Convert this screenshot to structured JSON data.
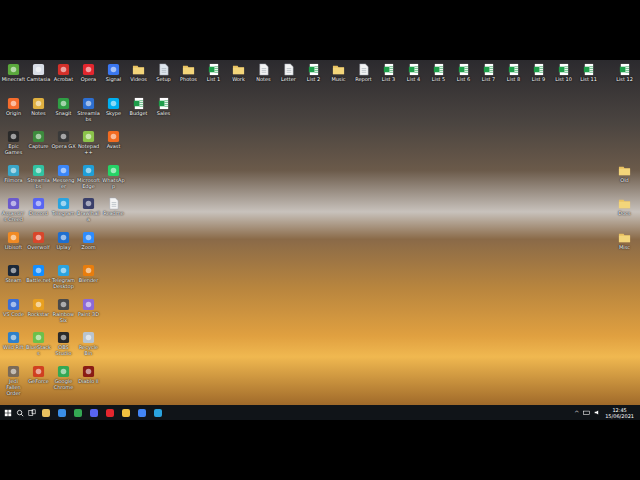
{
  "desktop": {
    "columns": [
      {
        "icons": [
          {
            "label": "Minecraft",
            "kind": "app",
            "color": "#5aa83c"
          },
          {
            "label": "Origin",
            "kind": "app",
            "color": "#f56c2d"
          },
          {
            "label": "Epic Games",
            "kind": "app",
            "color": "#2a2a2a"
          },
          {
            "label": "Filmora",
            "kind": "app",
            "color": "#3aa6c8"
          },
          {
            "label": "Assassin's Creed",
            "kind": "app",
            "color": "#6a5acd"
          },
          {
            "label": "Ubisoft",
            "kind": "app",
            "color": "#f08a24"
          },
          {
            "label": "Steam",
            "kind": "app",
            "color": "#1b2838"
          },
          {
            "label": "VS Code",
            "kind": "app",
            "color": "#3b6fd6"
          },
          {
            "label": "Wild Rift",
            "kind": "app",
            "color": "#2f80c9"
          },
          {
            "label": "Jedi Fallen Order",
            "kind": "app",
            "color": "#7a6a58"
          }
        ]
      },
      {
        "icons": [
          {
            "label": "Camtasia",
            "kind": "app",
            "color": "#d8dde6"
          },
          {
            "label": "Notes",
            "kind": "app",
            "color": "#e0b040"
          },
          {
            "label": "Capture",
            "kind": "app",
            "color": "#3d8b3d"
          },
          {
            "label": "Streamlabs",
            "kind": "app",
            "color": "#31c3a2"
          },
          {
            "label": "Discord",
            "kind": "app",
            "color": "#5865f2"
          },
          {
            "label": "Overwolf",
            "kind": "app",
            "color": "#d9462b"
          },
          {
            "label": "Battle.net",
            "kind": "app",
            "color": "#148eff"
          },
          {
            "label": "Rockstar",
            "kind": "app",
            "color": "#e8a020"
          },
          {
            "label": "BlueStacks",
            "kind": "app",
            "color": "#6cc04a"
          },
          {
            "label": "GeForce",
            "kind": "app",
            "color": "#d04020"
          }
        ]
      },
      {
        "icons": [
          {
            "label": "Acrobat",
            "kind": "app",
            "color": "#d4302a"
          },
          {
            "label": "Snagit",
            "kind": "app",
            "color": "#2f9e44"
          },
          {
            "label": "Opera GX",
            "kind": "app",
            "color": "#3a3a3a"
          },
          {
            "label": "Messenger",
            "kind": "app",
            "color": "#3b86f7"
          },
          {
            "label": "Telegram",
            "kind": "app",
            "color": "#2aa3df"
          },
          {
            "label": "Uplay",
            "kind": "app",
            "color": "#1f6fd0"
          },
          {
            "label": "Telegram Desktop",
            "kind": "app",
            "color": "#2aa3df"
          },
          {
            "label": "Rainbow Six",
            "kind": "app",
            "color": "#4a4a4a"
          },
          {
            "label": "OBS Studio",
            "kind": "app",
            "color": "#2a2a2a"
          },
          {
            "label": "Google Chrome",
            "kind": "app",
            "color": "#34a853"
          }
        ]
      },
      {
        "icons": [
          {
            "label": "Opera",
            "kind": "app",
            "color": "#e3262e"
          },
          {
            "label": "Streamlabs",
            "kind": "app",
            "color": "#2d6fd1"
          },
          {
            "label": "Notepad++",
            "kind": "app",
            "color": "#8bc34a"
          },
          {
            "label": "Microsoft Edge",
            "kind": "app",
            "color": "#1f9fd8"
          },
          {
            "label": "Brawlhalla",
            "kind": "app",
            "color": "#3a3f6a"
          },
          {
            "label": "Zoom",
            "kind": "app",
            "color": "#2d8cff"
          },
          {
            "label": "Blender",
            "kind": "app",
            "color": "#e87d0d"
          },
          {
            "label": "Paint 3D",
            "kind": "app",
            "color": "#8c6ad8"
          },
          {
            "label": "Recycle Bin",
            "kind": "app",
            "color": "#b8c4d0"
          },
          {
            "label": "Diablo II",
            "kind": "app",
            "color": "#8a1c14"
          }
        ]
      },
      {
        "icons": [
          {
            "label": "Signal",
            "kind": "app",
            "color": "#3a76f0"
          },
          {
            "label": "Skype",
            "kind": "app",
            "color": "#00aff0"
          },
          {
            "label": "Avast",
            "kind": "app",
            "color": "#f26b21"
          },
          {
            "label": "WhatsApp",
            "kind": "app",
            "color": "#25d366"
          },
          {
            "label": "Readme",
            "kind": "doc",
            "color": "#f4f4f4"
          }
        ]
      },
      {
        "icons": [
          {
            "label": "Videos",
            "kind": "folder",
            "color": "#e8c060"
          },
          {
            "label": "Budget",
            "kind": "sheet",
            "color": "#1e9e4a"
          }
        ]
      },
      {
        "icons": [
          {
            "label": "Setup",
            "kind": "doc",
            "color": "#dfe6ee"
          },
          {
            "label": "Sales",
            "kind": "sheet",
            "color": "#1e9e4a"
          }
        ]
      },
      {
        "icons": [
          {
            "label": "Photos",
            "kind": "folder",
            "color": "#e8c060"
          }
        ]
      },
      {
        "icons": [
          {
            "label": "List 1",
            "kind": "sheet",
            "color": "#1e9e4a"
          }
        ]
      },
      {
        "icons": [
          {
            "label": "Work",
            "kind": "folder",
            "color": "#e8c060"
          }
        ]
      },
      {
        "icons": [
          {
            "label": "Notes",
            "kind": "doc",
            "color": "#f4f4f4"
          }
        ]
      },
      {
        "icons": [
          {
            "label": "Letter",
            "kind": "doc",
            "color": "#f4f4f4"
          }
        ]
      },
      {
        "icons": [
          {
            "label": "List 2",
            "kind": "sheet",
            "color": "#1e9e4a"
          }
        ]
      },
      {
        "icons": [
          {
            "label": "Music",
            "kind": "folder",
            "color": "#e8c060"
          }
        ]
      },
      {
        "icons": [
          {
            "label": "Report",
            "kind": "doc",
            "color": "#f4f4f4"
          }
        ]
      },
      {
        "icons": [
          {
            "label": "List 3",
            "kind": "sheet",
            "color": "#1e9e4a"
          }
        ]
      },
      {
        "icons": [
          {
            "label": "List 4",
            "kind": "sheet",
            "color": "#1e9e4a"
          }
        ]
      },
      {
        "icons": [
          {
            "label": "List 5",
            "kind": "sheet",
            "color": "#1e9e4a"
          }
        ]
      },
      {
        "icons": [
          {
            "label": "List 6",
            "kind": "sheet",
            "color": "#1e9e4a"
          }
        ]
      },
      {
        "icons": [
          {
            "label": "List 7",
            "kind": "sheet",
            "color": "#1e9e4a"
          }
        ]
      },
      {
        "icons": [
          {
            "label": "List 8",
            "kind": "sheet",
            "color": "#1e9e4a"
          }
        ]
      },
      {
        "icons": [
          {
            "label": "List 9",
            "kind": "sheet",
            "color": "#1e9e4a"
          }
        ]
      },
      {
        "icons": [
          {
            "label": "List 10",
            "kind": "sheet",
            "color": "#1e9e4a"
          }
        ]
      },
      {
        "icons": [
          {
            "label": "List 11",
            "kind": "sheet",
            "color": "#1e9e4a"
          }
        ]
      }
    ],
    "right_column": {
      "icons": [
        {
          "label": "List 12",
          "kind": "sheet",
          "color": "#1e9e4a"
        },
        {
          "label": "Old",
          "kind": "folder",
          "color": "#e8c060"
        },
        {
          "label": "Docs",
          "kind": "folder",
          "color": "#e8c060"
        },
        {
          "label": "Misc",
          "kind": "folder",
          "color": "#e8c060"
        }
      ]
    }
  },
  "taskbar": {
    "pinned": [
      {
        "name": "explorer",
        "color": "#e8c060"
      },
      {
        "name": "store",
        "color": "#3a8ee6"
      },
      {
        "name": "chrome",
        "color": "#34a853"
      },
      {
        "name": "discord",
        "color": "#5865f2"
      },
      {
        "name": "opera",
        "color": "#e3262e"
      },
      {
        "name": "files",
        "color": "#f0c040"
      },
      {
        "name": "chrome-2",
        "color": "#4285f4"
      },
      {
        "name": "app",
        "color": "#2aa3df"
      }
    ],
    "tray": {
      "chevron": "^",
      "time": "12:45",
      "date": "15/06/2021"
    }
  }
}
